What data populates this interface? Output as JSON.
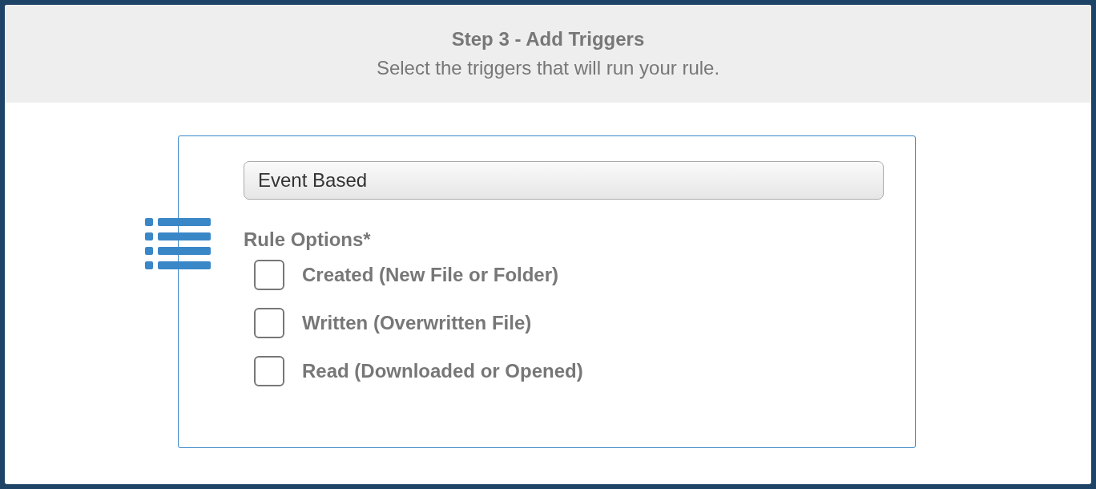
{
  "header": {
    "title": "Step 3 - Add Triggers",
    "subtitle": "Select the triggers that will run your rule."
  },
  "trigger_type": {
    "value": "Event Based"
  },
  "rule_options": {
    "label": "Rule Options*",
    "options": [
      {
        "label": "Created (New File or Folder)",
        "checked": false
      },
      {
        "label": "Written (Overwritten File)",
        "checked": false
      },
      {
        "label": "Read (Downloaded or Opened)",
        "checked": false
      }
    ]
  }
}
